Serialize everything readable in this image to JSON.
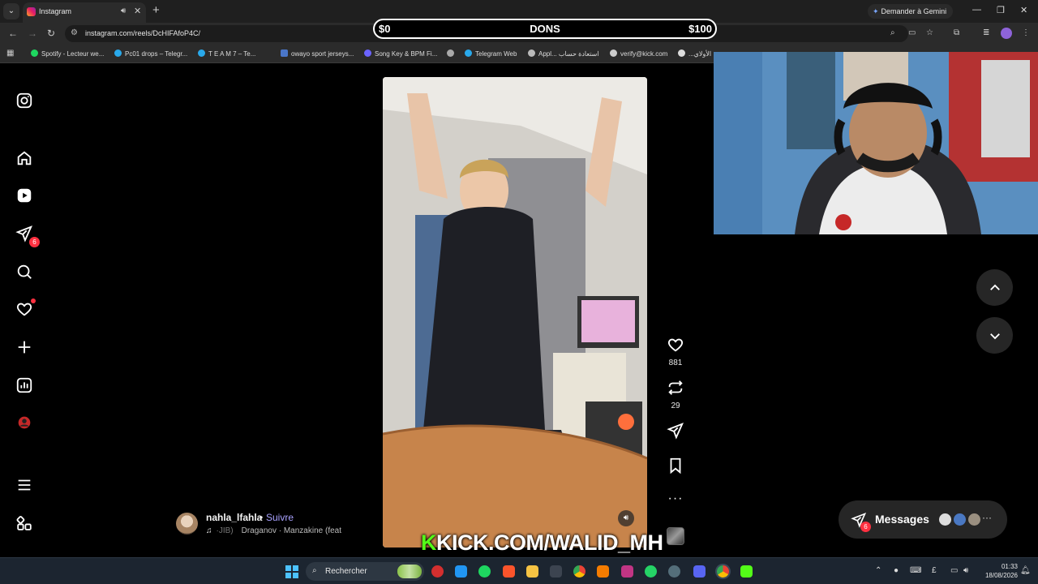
{
  "browser": {
    "tab_title": "Instagram",
    "url": "instagram.com/reels/DcHIFAfoP4C/",
    "gemini_label": "Demander à Gemini",
    "bookmarks": [
      "Spotify - Lecteur we...",
      "Pc01 drops – Telegr...",
      "T E A M 7 – Te...",
      "owayo sport jerseys...",
      "Song Key & BPM Fi...",
      "Telegram Web",
      "Appl... استعادة حساب",
      "verify@kick.com",
      "...الأولاي"
    ]
  },
  "donation_bar": {
    "min": "$0",
    "label": "DONS",
    "max": "$100"
  },
  "sidebar": {
    "messages_badge": "6",
    "items": [
      "instagram-logo",
      "home",
      "reels",
      "messages",
      "search",
      "notifications",
      "create",
      "dashboard",
      "profile",
      "more",
      "also-from-meta"
    ]
  },
  "reel": {
    "author": "nahla_lfahla",
    "separator": "•",
    "follow_label": "Suivre",
    "audio_prefix": "·JIB)",
    "audio_track": "Draganov · Manzakine (feat",
    "likes": "881",
    "reposts": "29"
  },
  "messages": {
    "label": "Messages",
    "badge": "6"
  },
  "stream": {
    "watermark_brand": "K",
    "watermark_text": "KICK.COM/WALID_MH"
  },
  "taskbar": {
    "search_placeholder": "Rechercher",
    "time": "01:33",
    "date": "18/08/2026"
  },
  "colors": {
    "accent_follow": "#a9a2ff",
    "badge_red": "#ff3040",
    "kick_green": "#53fc18"
  }
}
